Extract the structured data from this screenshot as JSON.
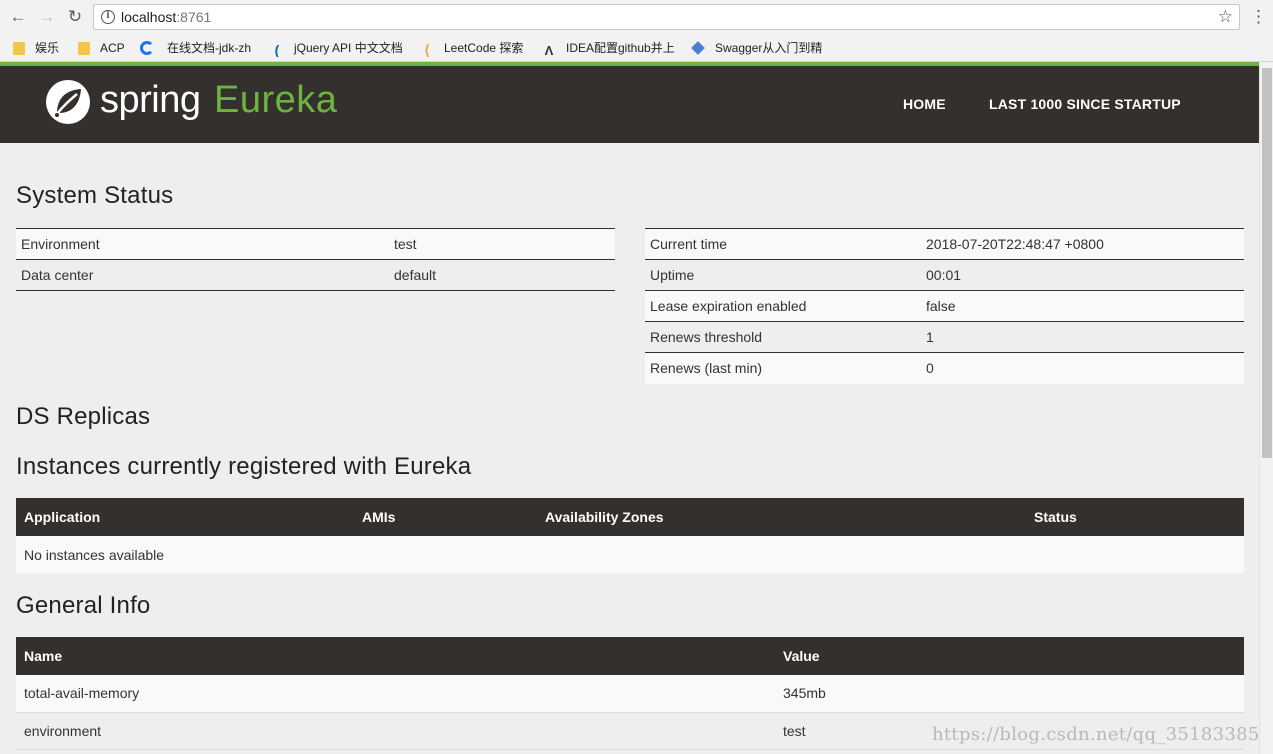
{
  "browser": {
    "url_host": "localhost",
    "url_port": ":8761",
    "bookmarks": [
      {
        "label": "娱乐",
        "icon": "folder-icon"
      },
      {
        "label": "ACP",
        "icon": "folder-icon"
      },
      {
        "label": "在线文档-jdk-zh",
        "icon": "c-logo-icon"
      },
      {
        "label": "jQuery API 中文文档",
        "icon": "jquery-logo-icon"
      },
      {
        "label": "LeetCode 探索",
        "icon": "leetcode-logo-icon"
      },
      {
        "label": "IDEA配置github并上",
        "icon": "idea-logo-icon"
      },
      {
        "label": "Swagger从入门到精",
        "icon": "swagger-logo-icon"
      }
    ]
  },
  "navbar": {
    "brand_spring": "spring",
    "brand_eureka": "Eureka",
    "links": [
      "HOME",
      "LAST 1000 SINCE STARTUP"
    ]
  },
  "system_status": {
    "title": "System Status",
    "left": [
      {
        "key": "Environment",
        "value": "test"
      },
      {
        "key": "Data center",
        "value": "default"
      }
    ],
    "right": [
      {
        "key": "Current time",
        "value": "2018-07-20T22:48:47 +0800"
      },
      {
        "key": "Uptime",
        "value": "00:01"
      },
      {
        "key": "Lease expiration enabled",
        "value": "false"
      },
      {
        "key": "Renews threshold",
        "value": "1"
      },
      {
        "key": "Renews (last min)",
        "value": "0"
      }
    ]
  },
  "ds_replicas": {
    "title": "DS Replicas"
  },
  "instances": {
    "title": "Instances currently registered with Eureka",
    "columns": [
      "Application",
      "AMIs",
      "Availability Zones",
      "Status"
    ],
    "empty_text": "No instances available"
  },
  "general_info": {
    "title": "General Info",
    "columns": [
      "Name",
      "Value"
    ],
    "rows": [
      {
        "name": "total-avail-memory",
        "value": "345mb"
      },
      {
        "name": "environment",
        "value": "test"
      }
    ]
  },
  "watermark": "https://blog.csdn.net/qq_35183385",
  "colors": {
    "accent": "#6db33f",
    "navbar": "#34302d",
    "page_bg": "#eeeeee"
  }
}
